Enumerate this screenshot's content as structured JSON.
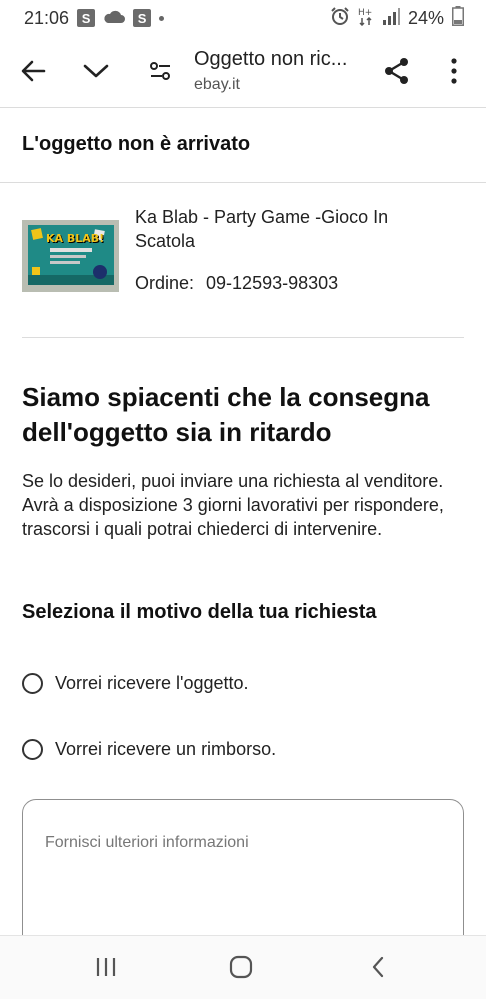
{
  "status_bar": {
    "time": "21:06",
    "battery_percent": "24%",
    "icons": [
      "samsung-s-icon",
      "cloud-icon",
      "samsung-s-icon",
      "dot-icon",
      "alarm-icon",
      "hplus-data-icon",
      "signal-icon",
      "battery-icon"
    ]
  },
  "toolbar": {
    "page_title": "Oggetto non ric...",
    "url": "ebay.it",
    "icons": [
      "back-arrow-icon",
      "chevron-down-icon",
      "tune-settings-icon",
      "share-icon",
      "more-vert-icon"
    ]
  },
  "page": {
    "header": "L'oggetto non è arrivato"
  },
  "item": {
    "title": "Ka Blab - Party Game -Gioco In Scatola",
    "order_label": "Ordine:",
    "order_number": "09-12593-98303",
    "thumb_text": "KA BLAB!"
  },
  "content": {
    "headline": "Siamo spiacenti che la consegna dell'oggetto sia in ritardo",
    "description": "Se lo desideri, puoi inviare una richiesta al venditore. Avrà a disposizione 3 giorni lavorativi per rispondere, trascorsi i quali potrai chiederci di intervenire.",
    "reason_title": "Seleziona il motivo della tua richiesta",
    "options": [
      {
        "label": "Vorrei ricevere l'oggetto.",
        "selected": false
      },
      {
        "label": "Vorrei ricevere un rimborso.",
        "selected": false
      }
    ],
    "more_info_placeholder": "Fornisci ulteriori informazioni"
  },
  "nav_bar": {
    "icons": [
      "recent-apps-icon",
      "home-icon",
      "back-icon"
    ]
  },
  "colors": {
    "text_primary": "#111111",
    "divider": "#dcdcdc",
    "border": "#8f8f8f",
    "background": "#ffffff"
  }
}
